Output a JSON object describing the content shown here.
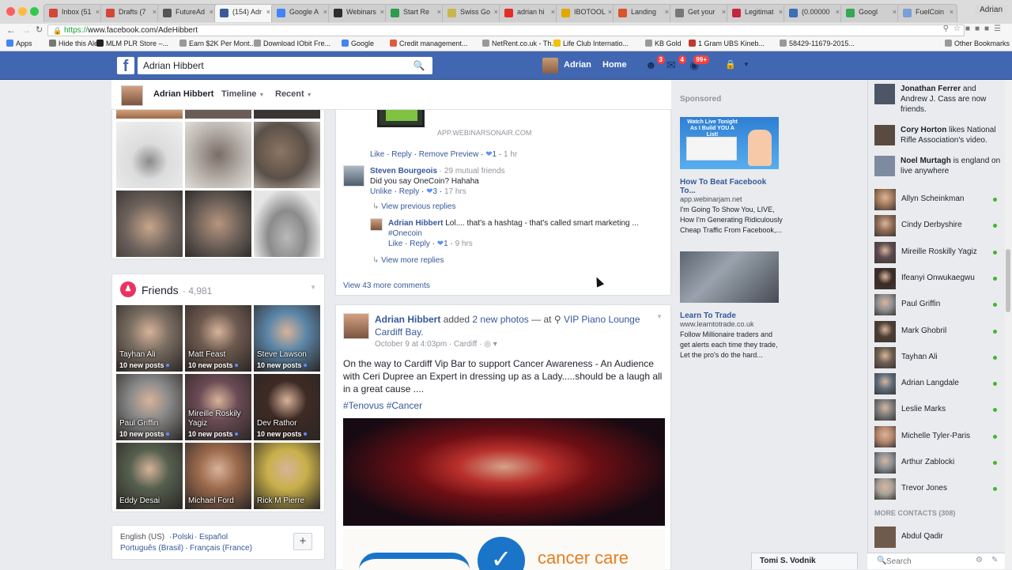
{
  "browser": {
    "tabs": [
      {
        "label": "Inbox (51",
        "color": "#d44638"
      },
      {
        "label": "Drafts (7",
        "color": "#d44638"
      },
      {
        "label": "FutureAd",
        "color": "#555555"
      },
      {
        "label": "(154) Adr",
        "color": "#3b5998"
      },
      {
        "label": "Google A",
        "color": "#4285f4"
      },
      {
        "label": "Webinars",
        "color": "#2d2d2d"
      },
      {
        "label": "Start Re",
        "color": "#2e9c4f"
      },
      {
        "label": "Swiss Go",
        "color": "#c8b64a"
      },
      {
        "label": "adrian hi",
        "color": "#e52d27"
      },
      {
        "label": "IBOTOOL",
        "color": "#e0a800"
      },
      {
        "label": "Landing",
        "color": "#d9532c"
      },
      {
        "label": "Get your",
        "color": "#777777"
      },
      {
        "label": "Legitimat",
        "color": "#c5283d"
      },
      {
        "label": "(0.00000",
        "color": "#3b6fb6"
      },
      {
        "label": "Googl",
        "color": "#34a853"
      },
      {
        "label": "FuelCoin",
        "color": "#7a9fd9"
      }
    ],
    "user_chip": "Adrian",
    "url_prefix": "https://",
    "url": "www.facebook.com/AdeHibbert",
    "bookmarks": [
      {
        "label": "Apps",
        "color": "#4285f4"
      },
      {
        "label": "Hide this Alert",
        "color": "#777777"
      },
      {
        "label": "MLM PLR Store –...",
        "color": "#222222"
      },
      {
        "label": "Earn $2K Per Mont...",
        "color": "#999999"
      },
      {
        "label": "Download IObit Fre...",
        "color": "#999999"
      },
      {
        "label": "Google",
        "color": "#4285f4"
      },
      {
        "label": "Credit management...",
        "color": "#e35b3f"
      },
      {
        "label": "NetRent.co.uk - Th...",
        "color": "#999999"
      },
      {
        "label": "Life Club Internatio...",
        "color": "#f2c200"
      },
      {
        "label": "KB Gold",
        "color": "#999999"
      },
      {
        "label": "1 Gram UBS Kineb...",
        "color": "#c0392b"
      },
      {
        "label": "58429-11679-2015...",
        "color": "#999999"
      },
      {
        "label": "Other Bookmarks",
        "color": "#999999"
      }
    ]
  },
  "fb": {
    "search_value": "Adrian Hibbert",
    "user_name": "Adrian",
    "home": "Home",
    "badges": [
      "3",
      "4",
      "99+"
    ]
  },
  "profile_strip": {
    "name": "Adrian Hibbert",
    "timeline": "Timeline",
    "recent": "Recent"
  },
  "friends": {
    "title": "Friends",
    "count": "· 4,981",
    "tiles": [
      {
        "name": "Tayhan Ali",
        "posts": "10 new posts",
        "bg": "#7c6f63"
      },
      {
        "name": "Matt Feast",
        "posts": "10 new posts",
        "bg": "#6e5a50"
      },
      {
        "name": "Steve Lawson",
        "posts": "10 new posts",
        "bg": "#5b86a8"
      },
      {
        "name": "Paul Griffin",
        "posts": "10 new posts",
        "bg": "#8a8a8a"
      },
      {
        "name": "Mireille Roskily Yagiz",
        "posts": "10 new posts",
        "bg": "#6b4b55"
      },
      {
        "name": "Dev Rathor",
        "posts": "10 new posts",
        "bg": "#3e2a24"
      },
      {
        "name": "Eddy Desai",
        "posts": "",
        "bg": "#56604f"
      },
      {
        "name": "Michael Ford",
        "posts": "",
        "bg": "#9c6a4c"
      },
      {
        "name": "Rick M Pierre",
        "posts": "",
        "bg": "#c9b04a"
      }
    ]
  },
  "languages": {
    "current": "English (US)",
    "l1": "Polski",
    "l2": "Español",
    "l3": "Português (Brasil)",
    "l4": "Français (France)"
  },
  "post1": {
    "link_url": "APP.WEBINARSONAIR.COM",
    "actions1": {
      "like": "Like",
      "reply": "Reply",
      "remove": "Remove Preview",
      "likes": "1",
      "time": "1 hr"
    },
    "comment": {
      "author": "Steven Bourgeois",
      "mutual": "· 29 mutual friends",
      "text": "Did you say OneCoin? Hahaha",
      "unlike": "Unlike",
      "reply": "Reply",
      "likes": "3",
      "time": "17 hrs"
    },
    "view_prev": "View previous replies",
    "reply": {
      "author": "Adrian Hibbert",
      "text": "Lol.... that's a hashtag - that's called smart marketing ...",
      "tag": "#Onecoin",
      "like": "Like",
      "reply": "Reply",
      "likes": "1",
      "time": "9 hrs"
    },
    "view_more_replies": "View more replies",
    "view_more_comments": "View 43 more comments"
  },
  "post2": {
    "author": "Adrian Hibbert",
    "added": "added",
    "photos": "2 new photos",
    "at": "— at",
    "place": "VIP Piano Lounge Cardiff Bay.",
    "meta": "October 9 at 4:03pm · Cardiff ·",
    "body": "On the way to Cardiff Vip Bar to support Cancer Awareness - An Audience with Ceri Dupree an Expert in dressing up as a Lady.....should be a laugh all in a great cause ....",
    "tags": "#Tenovus #Cancer",
    "banner_text": "cancer care"
  },
  "sponsored": {
    "heading": "Sponsored",
    "ad1": {
      "img_text": "Watch Live Tonight As I Build YOU A List!",
      "title": "How To Beat Facebook To...",
      "url": "app.webinarjam.net",
      "body": "I'm Going To Show You, LIVE, How I'm Generating Ridiculously Cheap Traffic From Facebook,..."
    },
    "ad2": {
      "title": "Learn To Trade",
      "url": "www.learntotrade.co.uk",
      "body": "Follow Millionaire traders and get alerts each time they trade, Let the pro's do the hard..."
    }
  },
  "chat": {
    "ticker": [
      {
        "bold": "Jonathan Ferrer",
        "rest": " and Andrew J. Cass are now friends."
      },
      {
        "bold": "Cory Horton",
        "rest": " likes National Rifle Association's video."
      },
      {
        "bold": "Noel Murtagh",
        "rest": " is england on live anywhere"
      }
    ],
    "contacts": [
      {
        "name": "Allyn Scheinkman",
        "bg": "#a47b5b"
      },
      {
        "name": "Cindy Derbyshire",
        "bg": "#8f6b55"
      },
      {
        "name": "Mireille Roskilly Yagiz",
        "bg": "#5e4a4f"
      },
      {
        "name": "Ifeanyi Onwukaegwu",
        "bg": "#3a2b25"
      },
      {
        "name": "Paul Griffin",
        "bg": "#909090"
      },
      {
        "name": "Mark Ghobril",
        "bg": "#4d3d33"
      },
      {
        "name": "Tayhan Ali",
        "bg": "#6d5e52"
      },
      {
        "name": "Adrian Langdale",
        "bg": "#5e6d7b"
      },
      {
        "name": "Leslie Marks",
        "bg": "#7d7d7d"
      },
      {
        "name": "Michelle Tyler-Paris",
        "bg": "#b6866d"
      },
      {
        "name": "Arthur Zablocki",
        "bg": "#8a8f95"
      },
      {
        "name": "Trevor Jones",
        "bg": "#a8a19a"
      }
    ],
    "more_contacts": "MORE CONTACTS (308)",
    "extra_contact": "Abdul Qadir",
    "search_placeholder": "Search",
    "open_chat": "Tomi S. Vodnik"
  }
}
